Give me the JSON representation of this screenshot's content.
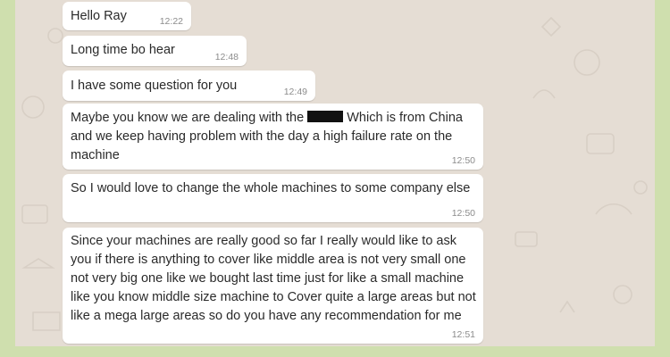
{
  "theme": {
    "outer_bg": "#cfdfae",
    "chat_bg": "#e5ddd4",
    "bubble_bg": "#ffffff",
    "timestamp_color": "#8c8c8c"
  },
  "messages": [
    {
      "text": "Hello Ray",
      "time": "12:22"
    },
    {
      "text": "Long time bo hear",
      "time": "12:48"
    },
    {
      "text": "I have some question for you",
      "time": "12:49"
    },
    {
      "text_before_redaction": "Maybe you know we are dealing with the",
      "text_after_redaction": "Which is from China and we keep having problem with the day a high failure rate on the machine",
      "time": "12:50"
    },
    {
      "text": "So I would love to change the whole machines to some company else",
      "time": "12:50"
    },
    {
      "text": "Since your machines are really good so far I really would like to ask you if there is anything to cover like middle area is not very small one not very big one like we bought last time just for like a small machine like you know middle size machine to Cover quite a large areas but not like a mega large areas so do you have any recommendation for me",
      "time": "12:51"
    }
  ]
}
